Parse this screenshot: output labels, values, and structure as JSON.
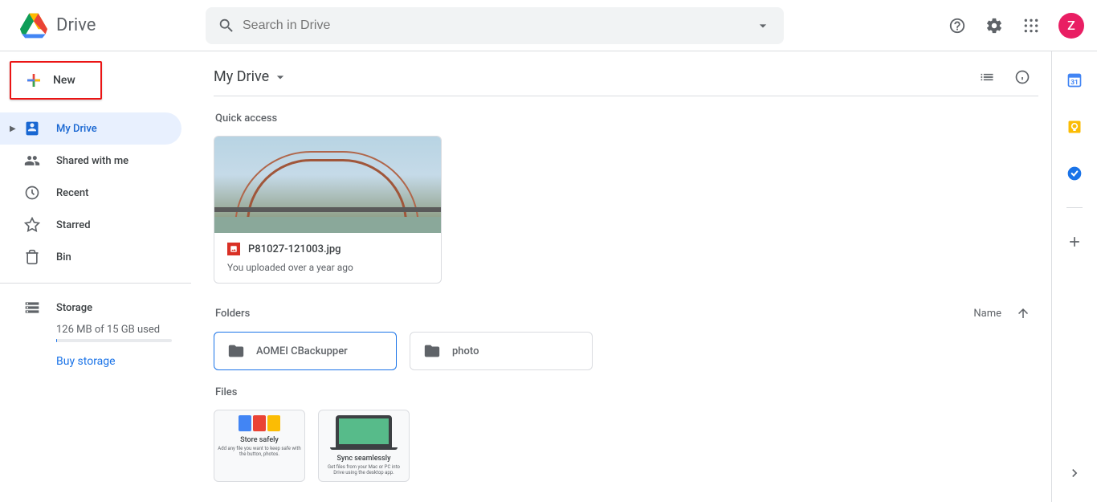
{
  "header": {
    "title": "Drive",
    "search_placeholder": "Search in Drive",
    "avatar_initial": "Z"
  },
  "sidebar": {
    "new_label": "New",
    "nav": [
      {
        "label": "My Drive",
        "active": true,
        "expandable": true
      },
      {
        "label": "Shared with me",
        "active": false,
        "expandable": false
      },
      {
        "label": "Recent",
        "active": false,
        "expandable": false
      },
      {
        "label": "Starred",
        "active": false,
        "expandable": false
      },
      {
        "label": "Bin",
        "active": false,
        "expandable": false
      }
    ],
    "storage_label": "Storage",
    "storage_usage": "126 MB of 15 GB used",
    "buy_label": "Buy storage"
  },
  "main": {
    "path": "My Drive",
    "quick_access_label": "Quick access",
    "folders_label": "Folders",
    "files_label": "Files",
    "sort_label": "Name",
    "qa_item": {
      "name": "P81027-121003.jpg",
      "subtitle": "You uploaded over a year ago"
    },
    "folders": [
      {
        "name": "AOMEI CBackupper",
        "selected": true
      },
      {
        "name": "photo",
        "selected": false
      }
    ],
    "promo": {
      "card1": {
        "title": "Store safely",
        "sub": "Add any file you want to keep safe with the button, photos."
      },
      "card2": {
        "title": "Sync seamlessly",
        "sub": "Get files from your Mac or PC into Drive using the desktop app."
      }
    }
  },
  "colors": {
    "accent": "#1a73e8",
    "highlight_border": "#eb1414",
    "avatar_bg": "#e91e63"
  }
}
